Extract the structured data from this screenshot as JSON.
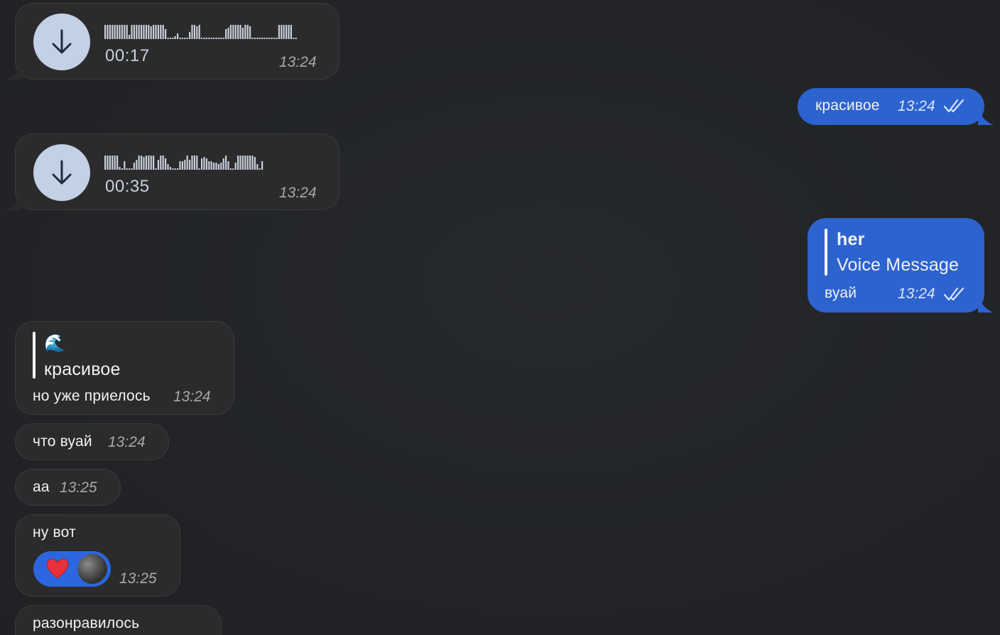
{
  "messages": {
    "voice1": {
      "duration": "00:17",
      "time": "13:24"
    },
    "out1": {
      "text": "красивое",
      "time": "13:24"
    },
    "voice2": {
      "duration": "00:35",
      "time": "13:24"
    },
    "out2": {
      "reply_author": "her",
      "reply_text": "Voice Message",
      "text": "вуай",
      "time": "13:24"
    },
    "in1": {
      "reply_emoji": "🌊",
      "reply_text": "красивое",
      "text": "но уже приелось",
      "time": "13:24"
    },
    "in2": {
      "text": "что вуай",
      "time": "13:24"
    },
    "in3": {
      "text": "аа",
      "time": "13:25"
    },
    "in4": {
      "text": "ну вот",
      "reaction": "heart",
      "time": "13:25"
    },
    "in5": {
      "text": "разонравилось"
    }
  },
  "colors": {
    "incoming_bubble": "#2b2b2c",
    "outgoing_bubble": "#2c63cf",
    "reaction_pill": "#2b66e0",
    "download_button": "#c3d1e6",
    "background": "#222427"
  },
  "icons": {
    "download": "arrow-down-icon",
    "read_receipt": "double-check-icon",
    "reaction": "heart-icon"
  }
}
